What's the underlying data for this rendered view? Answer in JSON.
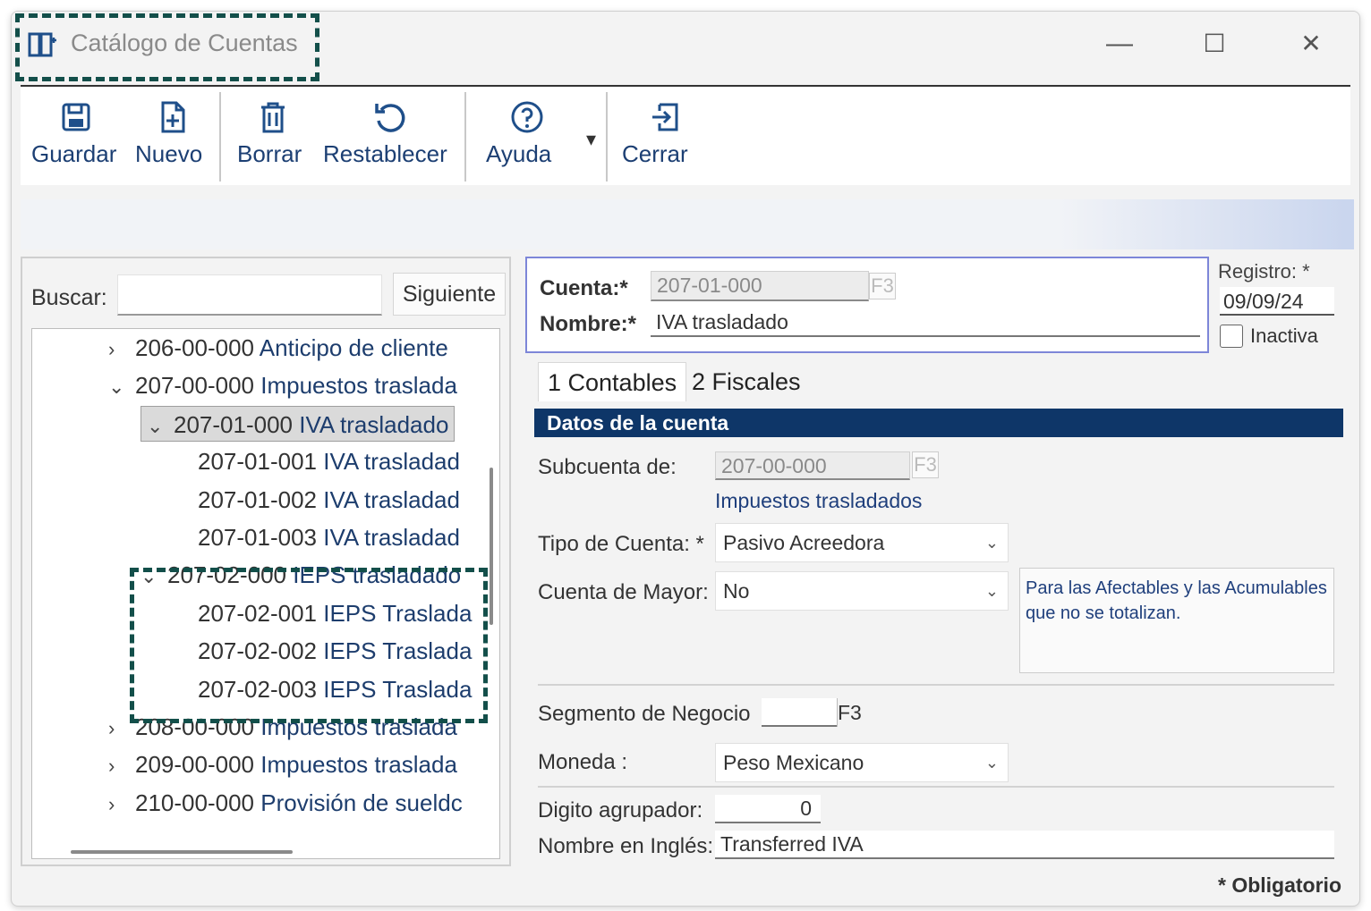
{
  "window": {
    "title": "Catálogo de Cuentas",
    "minimize": "—",
    "maximize": "☐",
    "close": "✕"
  },
  "toolbar": {
    "save": "Guardar",
    "new": "Nuevo",
    "delete": "Borrar",
    "reset": "Restablecer",
    "help": "Ayuda",
    "help_arrow": "▾",
    "close": "Cerrar"
  },
  "search": {
    "label": "Buscar:",
    "value": "",
    "next": "Siguiente"
  },
  "tree": [
    {
      "chevron": "›",
      "code": "206-00-000",
      "name": "Anticipo de cliente"
    },
    {
      "chevron": "⌄",
      "code": "207-00-000",
      "name": "Impuestos traslada"
    },
    {
      "chevron": "⌄",
      "code": "207-01-000",
      "name": "IVA trasladado",
      "selected": true
    },
    {
      "chevron": "",
      "code": "207-01-001",
      "name": "IVA trasladad"
    },
    {
      "chevron": "",
      "code": "207-01-002",
      "name": "IVA trasladad"
    },
    {
      "chevron": "",
      "code": "207-01-003",
      "name": "IVA trasladad"
    },
    {
      "chevron": "⌄",
      "code": "207-02-000",
      "name": "IEPS trasladado"
    },
    {
      "chevron": "",
      "code": "207-02-001",
      "name": "IEPS Traslada"
    },
    {
      "chevron": "",
      "code": "207-02-002",
      "name": "IEPS Traslada"
    },
    {
      "chevron": "",
      "code": "207-02-003",
      "name": "IEPS Traslada"
    },
    {
      "chevron": "›",
      "code": "208-00-000",
      "name": "Impuestos traslada"
    },
    {
      "chevron": "›",
      "code": "209-00-000",
      "name": "Impuestos traslada"
    },
    {
      "chevron": "›",
      "code": "210-00-000",
      "name": "Provisión de sueldc"
    }
  ],
  "account": {
    "cuenta_label": "Cuenta:*",
    "cuenta_value": "207-01-000",
    "f3": "F3",
    "nombre_label": "Nombre:*",
    "nombre_value": "IVA trasladado",
    "registro_label": "Registro: *",
    "registro_value": "09/09/24",
    "inactiva_label": "Inactiva"
  },
  "tabs": [
    "1 Contables",
    "2 Fiscales"
  ],
  "section": {
    "header": "Datos de la cuenta",
    "subcuenta_label": "Subcuenta de:",
    "subcuenta_value": "207-00-000",
    "subcuenta_desc": "Impuestos trasladados",
    "tipo_label": "Tipo de Cuenta: *",
    "tipo_value": "Pasivo Acreedora",
    "mayor_label": "Cuenta de Mayor:",
    "mayor_value": "No",
    "note": "Para las Afectables y las Acumulables que no se totalizan.",
    "segmento_label": "Segmento de Negocio",
    "segmento_value": "",
    "segmento_f3": "F3",
    "moneda_label": "Moneda :",
    "moneda_value": "Peso Mexicano",
    "digito_label": "Digito agrupador:",
    "digito_value": "0",
    "ingles_label": "Nombre en Inglés:",
    "ingles_value": "Transferred IVA"
  },
  "footer": {
    "required_note": "* Obligatorio"
  },
  "colors": {
    "accent": "#0e3668",
    "highlight": "#134f4a",
    "link_text": "#1d3d6d"
  }
}
